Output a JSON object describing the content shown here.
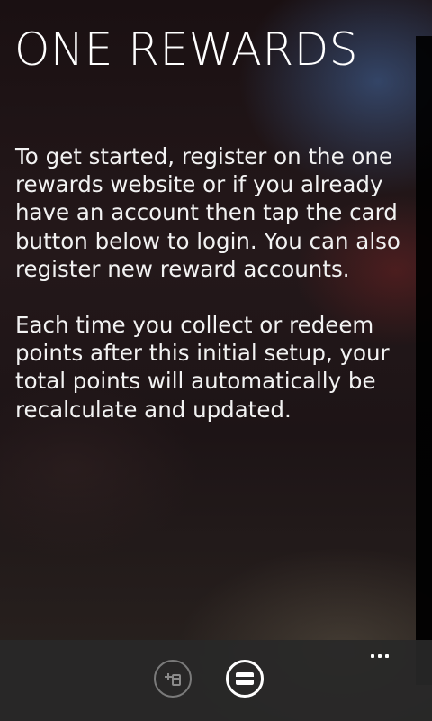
{
  "page": {
    "title": "ONE REWARDS",
    "paragraphs": [
      "To get started, register on the one rewards website or if you already have an account then tap the card button below to login. You can also register new reward accounts.",
      "Each time you collect or redeem points after this initial setup, your total points will automatically be recalculate and updated."
    ]
  },
  "app_bar": {
    "buttons": [
      {
        "icon": "add-card-icon"
      },
      {
        "icon": "card-icon"
      }
    ],
    "more_icon": "ellipsis-icon"
  }
}
